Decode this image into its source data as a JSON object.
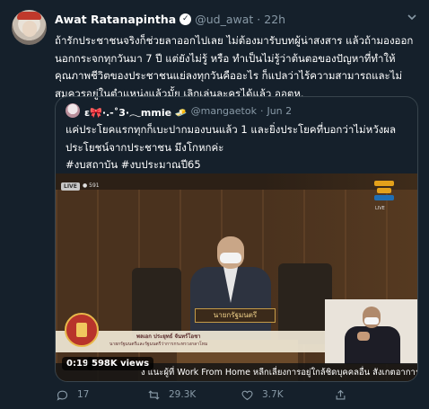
{
  "tweet": {
    "author_name": "Awat Ratanapintha",
    "handle": "@ud_awat",
    "separator": "·",
    "time": "22h",
    "text_lines": [
      "ถ้ารักประชาชนจริงก็ช่วยลาออกไปเลย ไม่ต้องมารับบทผู้น่าสงสาร แล้วถ้ามองออก",
      "นอกกระจกทุกวันมา 7 ปี แต่ยังไม่รู้ หรือ ทำเป็นไม่รู้ว่าต้นตอของปัญหาที่ทำให้",
      "คุณภาพชีวิตของประชาชนแย่ลงทุกวันคืออะไร ก็แปลว่าไร้ความสามารถและไม่",
      "สมควรอยู่ในตำแหน่งแล้วมั้ย เลิกเล่นละครได้แล้ว ออตห."
    ]
  },
  "quote": {
    "author_name": "ε🎀·.-˚3·𓂃mmie 🧈",
    "handle": "@mangaetok",
    "separator": "·",
    "time": "Jun 2",
    "text_lines": [
      "แค่ประโยคแรกทุกก็เบะปากมองบนแล้ว 1 และยิ่งประโยคที่บอกว่าไม่หวังผล",
      "ประโยชน์จากประชาชน มึงโกหกค่ะ",
      "#งบสถาบัน #งบประมาณปี65"
    ]
  },
  "video": {
    "live_badge": "LIVE",
    "top_views": "591",
    "channel_logo_text": "LIVE",
    "nameplate": "นายกรัฐมนตรี",
    "lower_third_name": "พลเอก ประยุทธ์ จันทร์โอชา",
    "lower_third_title": "นายกรัฐมนตรีและรัฐมนตรีว่าการกระทรวงกลาโหม",
    "ticker": "ง แนะผู้ที่ Work From Home หลีกเลี่ยงการอยู่ใกล้ชิดบุคคลอื่น สังเกตอาการ",
    "duration": "0:19",
    "views": "598K views"
  },
  "actions": {
    "reply_count": "17",
    "retweet_count": "29.3K",
    "like_count": "3.7K",
    "share_count": ""
  },
  "colors": {
    "background": "#15202b",
    "secondary_text": "#8899a6",
    "border": "#38444d"
  }
}
